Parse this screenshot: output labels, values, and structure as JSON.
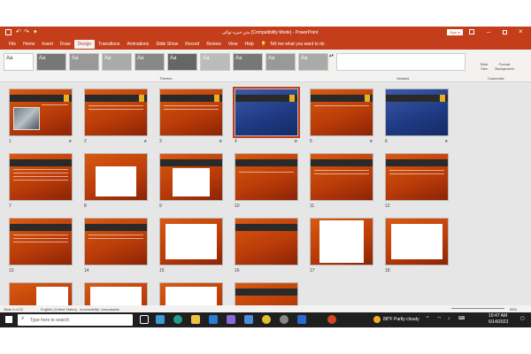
{
  "window": {
    "title": "متن خیره توالی [Compatibility Mode] - PowerPoint",
    "sign_in": "Sign in"
  },
  "tabs": [
    "File",
    "Home",
    "Insert",
    "Draw",
    "Design",
    "Transitions",
    "Animations",
    "Slide Show",
    "Record",
    "Review",
    "View",
    "Help"
  ],
  "active_tab": "Design",
  "tell_me": "Tell me what you want to do",
  "ribbon": {
    "themes_label": "Themes",
    "variants_label": "Variants",
    "customize_label": "Customize",
    "slide_size": "Slide Size",
    "format_background": "Format Background",
    "theme_sample": "Aa"
  },
  "slides": {
    "numbers": [
      "1",
      "2",
      "3",
      "4",
      "5",
      "6",
      "7",
      "8",
      "9",
      "10",
      "11",
      "12",
      "13",
      "14",
      "15",
      "16",
      "17",
      "18",
      "19",
      "20",
      "21",
      "22"
    ]
  },
  "status": {
    "slide_info": "Slide 4 of 22",
    "language": "English (United States)",
    "accessibility": "Accessibility: Unavailable",
    "zoom": "55%"
  },
  "taskbar": {
    "search_placeholder": "Type here to search",
    "weather": "88°F  Partly cloudy",
    "time": "10:47 AM",
    "date": "6/14/2023"
  }
}
